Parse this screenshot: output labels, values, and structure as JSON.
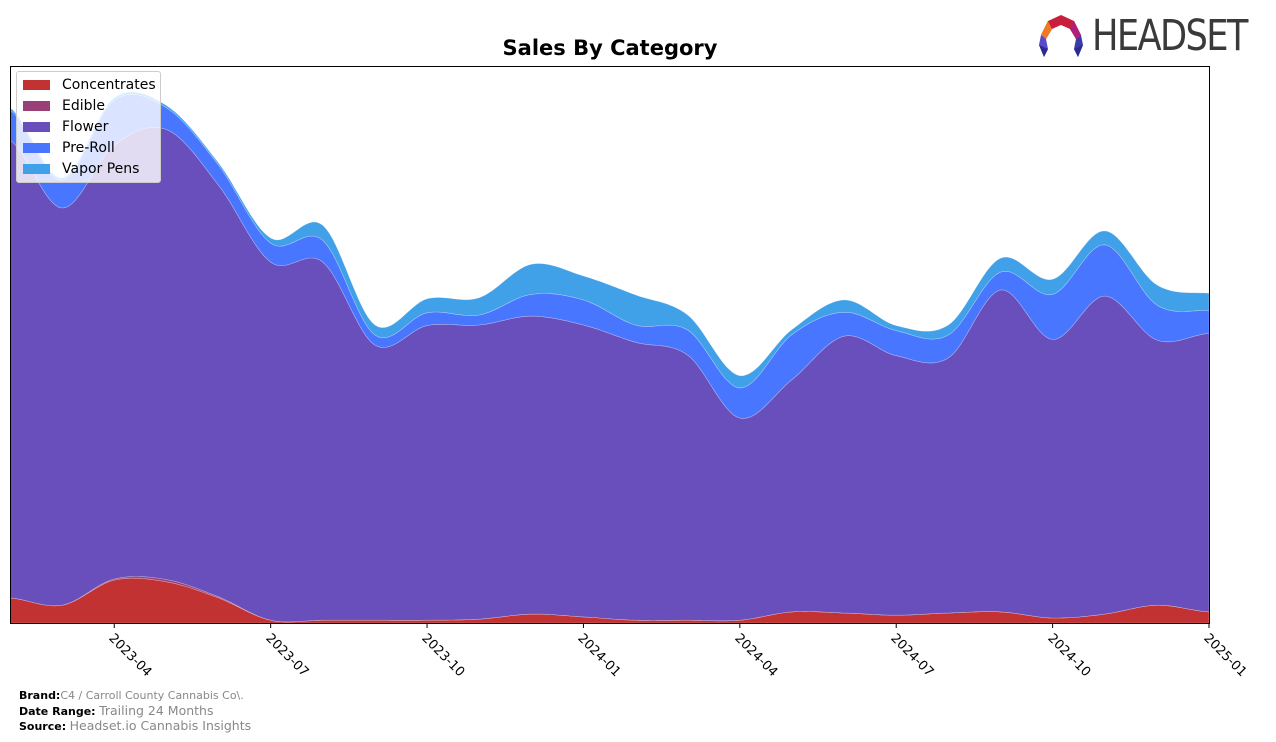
{
  "chart_data": {
    "type": "area",
    "stacked": true,
    "smoothed": true,
    "title": "Sales By Category",
    "xlabel": "",
    "ylabel": "",
    "y_ticks_visible": false,
    "ylim": [
      0,
      100
    ],
    "x": [
      "2023-02",
      "2023-03",
      "2023-04",
      "2023-05",
      "2023-06",
      "2023-07",
      "2023-08",
      "2023-09",
      "2023-10",
      "2023-11",
      "2023-12",
      "2024-01",
      "2024-02",
      "2024-03",
      "2024-04",
      "2024-05",
      "2024-06",
      "2024-07",
      "2024-08",
      "2024-09",
      "2024-10",
      "2024-11",
      "2024-12",
      "2025-01"
    ],
    "x_tick_labels": [
      "2023-04",
      "2023-07",
      "2023-10",
      "2024-01",
      "2024-04",
      "2024-07",
      "2024-10",
      "2025-01"
    ],
    "legend_position": "top-left",
    "series": [
      {
        "name": "Concentrates",
        "color": "#c23232",
        "values": [
          4.5,
          3.2,
          7.7,
          7.4,
          4.5,
          0.5,
          0.5,
          0.5,
          0.5,
          0.7,
          1.6,
          1.1,
          0.5,
          0.5,
          0.5,
          2.0,
          1.8,
          1.4,
          1.8,
          2.0,
          0.9,
          1.6,
          3.2,
          2.0
        ]
      },
      {
        "name": "Edible",
        "color": "#9a4079",
        "values": [
          0,
          0,
          0.2,
          0.4,
          0.2,
          0,
          0,
          0,
          0,
          0,
          0,
          0,
          0,
          0,
          0,
          0,
          0,
          0,
          0,
          0,
          0,
          0,
          0,
          0
        ]
      },
      {
        "name": "Flower",
        "color": "#694fbb",
        "values": [
          82.2,
          71.3,
          77.9,
          80.8,
          73.9,
          64.3,
          64.3,
          49.4,
          52.9,
          52.8,
          53.5,
          52.4,
          49.9,
          47.6,
          36.3,
          41.7,
          49.7,
          46.6,
          45.8,
          57.8,
          50.0,
          57.1,
          47.6,
          50.0
        ]
      },
      {
        "name": "Pre-Roll",
        "color": "#4876fe",
        "values": [
          5.4,
          5.0,
          8.1,
          3.9,
          3.6,
          3.4,
          3.9,
          1.8,
          2.3,
          1.8,
          3.9,
          4.5,
          3.1,
          4.5,
          5.4,
          8.1,
          4.3,
          4.5,
          4.1,
          3.2,
          8.1,
          9.2,
          6.3,
          4.1
        ]
      },
      {
        "name": "Vapor Pens",
        "color": "#40a0e8",
        "values": [
          0.4,
          0.4,
          0.4,
          0.4,
          0.4,
          0.9,
          2.7,
          1.8,
          2.5,
          3.1,
          5.4,
          4.3,
          5.4,
          2.7,
          2.2,
          0.9,
          2.2,
          0.9,
          1.8,
          2.5,
          2.7,
          2.5,
          3.6,
          3.1
        ]
      }
    ]
  },
  "logo": {
    "text": "HEADSET"
  },
  "footer": {
    "brand_label": "Brand:",
    "brand_value": "C4 / Carroll County Cannabis Co\\.",
    "date_range_label": "Date Range:",
    "date_range_value": "Trailing 24 Months",
    "source_label": "Source:",
    "source_value": "Headset.io Cannabis Insights"
  }
}
